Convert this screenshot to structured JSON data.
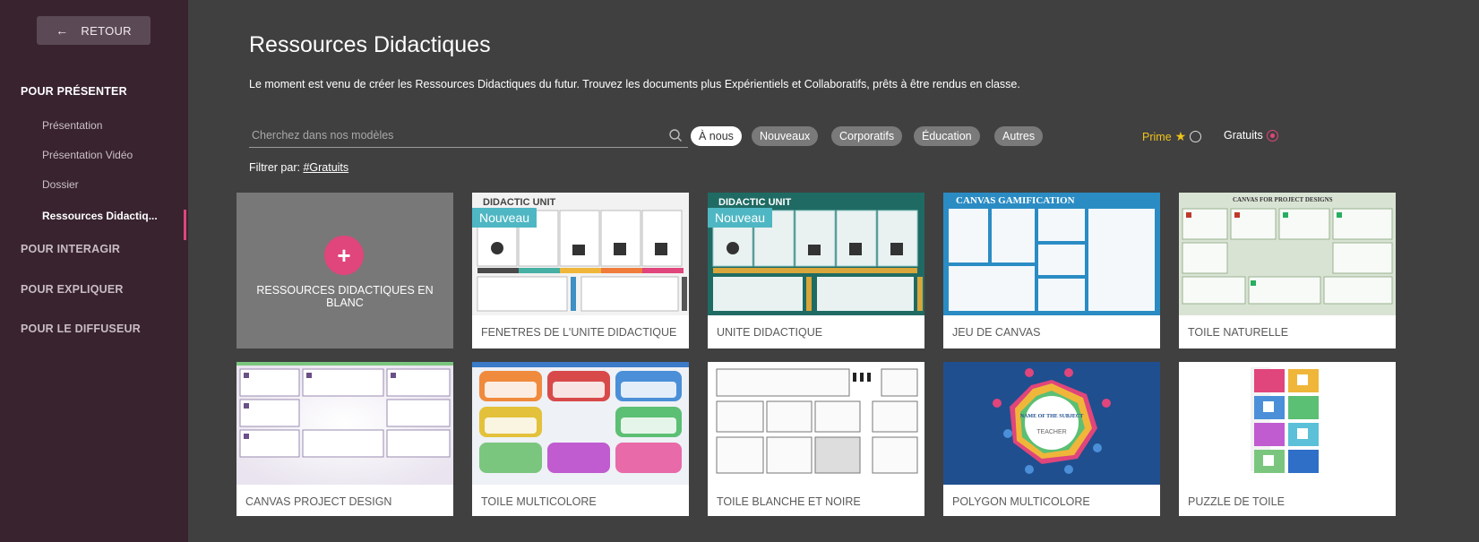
{
  "sidebar": {
    "back_label": "RETOUR",
    "sections": [
      {
        "label": "POUR PRÉSENTER",
        "items": [
          "Présentation",
          "Présentation Vidéo",
          "Dossier",
          "Ressources Didactiq..."
        ]
      },
      {
        "label": "POUR INTERAGIR"
      },
      {
        "label": "POUR EXPLIQUER"
      },
      {
        "label": "POUR LE DIFFUSEUR"
      }
    ]
  },
  "header": {
    "title": "Ressources Didactiques",
    "description": "Le moment est venu de créer les Ressources Didactiques du futur. Trouvez les documents plus Expérientiels et Collaboratifs, prêts à être rendus en classe."
  },
  "search": {
    "placeholder": "Cherchez dans nos modèles"
  },
  "chips": [
    "À nous",
    "Nouveaux",
    "Corporatifs",
    "Éducation",
    "Autres"
  ],
  "toggles": {
    "prime": "Prime",
    "free": "Gratuits"
  },
  "filter": {
    "prefix": "Filtrer par:",
    "tag": "#Gratuits"
  },
  "blank_card": {
    "label": "RESSOURCES DIDACTIQUES EN BLANC"
  },
  "badge": "Nouveau",
  "cards": [
    "FENETRES DE L'UNITE DIDACTIQUE",
    "UNITE DIDACTIQUE",
    "JEU DE CANVAS",
    "TOILE NATURELLE",
    "CANVAS PROJECT DESIGN",
    "TOILE MULTICOLORE",
    "TOILE BLANCHE ET NOIRE",
    "POLYGON MULTICOLORE",
    "PUZZLE DE TOILE"
  ],
  "thumb_text": {
    "didactic_unit": "DIDACTIC UNIT",
    "canvas_gamification": "CANVAS GAMIFICATION",
    "canvas_project": "CANVAS FOR PROJECT DESIGNS",
    "polygon_center": "NAME OF THE SUBJECT",
    "polygon_teacher": "TEACHER"
  },
  "colors": {
    "accent": "#e0457b",
    "sidebar": "#38232f",
    "main": "#404040",
    "prime": "#f0c419",
    "badge": "#4fb7c3"
  }
}
